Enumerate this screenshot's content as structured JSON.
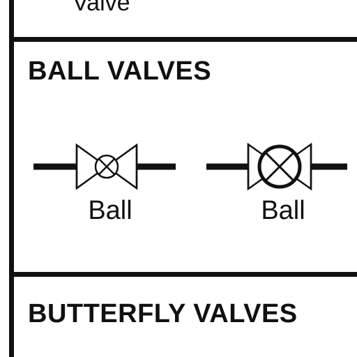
{
  "previous_section": {
    "partial_label": "Valve"
  },
  "ball_valves_section": {
    "heading": "BALL VALVES",
    "symbols": [
      {
        "label": "Ball",
        "icon": "ball-valve-small-circle-icon"
      },
      {
        "label": "Ball",
        "icon": "ball-valve-large-circle-icon"
      }
    ]
  },
  "butterfly_valves_section": {
    "heading": "BUTTERFLY VALVES"
  },
  "colors": {
    "ink": "#111111",
    "background": "#ffffff"
  }
}
